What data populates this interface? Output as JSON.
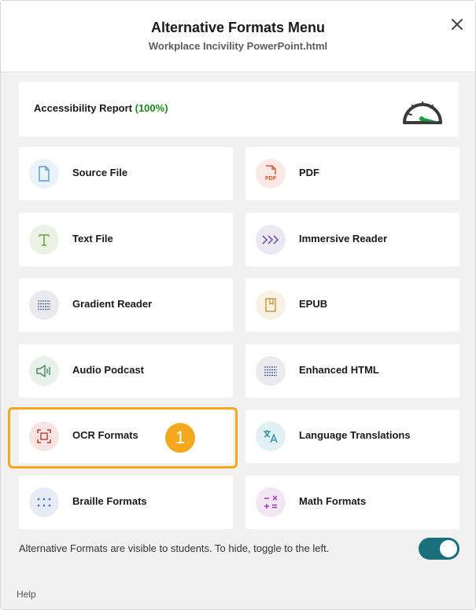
{
  "header": {
    "title": "Alternative Formats Menu",
    "filename": "Workplace Incivility PowerPoint.html",
    "close_icon": "close-icon"
  },
  "report": {
    "label": "Accessibility Report",
    "percent": "(100%)",
    "score_fraction": 1.0,
    "icon": "gauge-icon"
  },
  "formats": [
    {
      "label": "Source File",
      "icon": "document-icon",
      "color": "#5b9bd5"
    },
    {
      "label": "PDF",
      "icon": "pdf-icon",
      "color": "#d9542c"
    },
    {
      "label": "Text File",
      "icon": "text-icon",
      "color": "#6a9a3a"
    },
    {
      "label": "Immersive Reader",
      "icon": "immersive-reader-icon",
      "color": "#6b4aa0"
    },
    {
      "label": "Gradient Reader",
      "icon": "gradient-reader-icon",
      "color": "#4a5a8a"
    },
    {
      "label": "EPUB",
      "icon": "book-icon",
      "color": "#c9943a"
    },
    {
      "label": "Audio Podcast",
      "icon": "speaker-icon",
      "color": "#4a8a5a"
    },
    {
      "label": "Enhanced HTML",
      "icon": "enhanced-html-icon",
      "color": "#4a5a8a"
    },
    {
      "label": "OCR Formats",
      "icon": "ocr-icon",
      "color": "#c0392b"
    },
    {
      "label": "Language Translations",
      "icon": "translate-icon",
      "color": "#1a8a9a"
    },
    {
      "label": "Braille Formats",
      "icon": "braille-icon",
      "color": "#3a6ab0"
    },
    {
      "label": "Math Formats",
      "icon": "math-icon",
      "color": "#9a3ab0"
    }
  ],
  "callout": {
    "number": "1",
    "color": "#f3a81e"
  },
  "visibility": {
    "text": "Alternative Formats are visible to students. To hide, toggle to the left.",
    "enabled": true,
    "color": "#1a6f7c"
  },
  "footer": {
    "help": "Help"
  }
}
